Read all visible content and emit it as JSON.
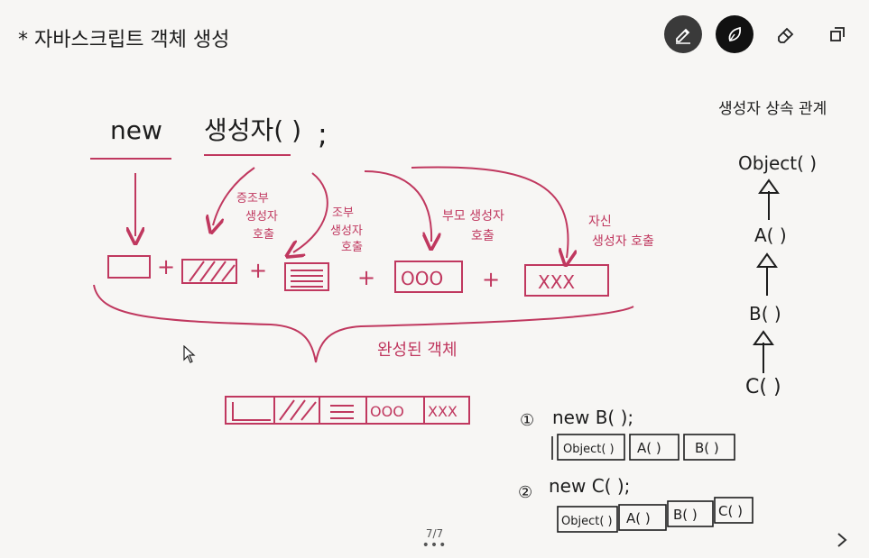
{
  "toolbar": {
    "tools": [
      {
        "icon": "pen-icon",
        "active": true
      },
      {
        "icon": "marker-icon",
        "active": true
      },
      {
        "icon": "eraser-icon",
        "active": false
      },
      {
        "icon": "lasso-select-icon",
        "active": false
      }
    ]
  },
  "colors": {
    "pen_dark": "#1d1d1d",
    "pen_pink": "#c0385f",
    "canvas": "#f7f6f4"
  },
  "note": {
    "title": "* 자바스크립트 객체 생성",
    "expr_new": "new",
    "expr_ctor": "생성자( )",
    "expr_semicolon": ";",
    "label_grand": "증조부 생성자 호출",
    "label_grand_lines": [
      "증조부",
      "생성자",
      "호출"
    ],
    "label_grandparent": "조부 생성자 호출",
    "label_grandparent_lines": [
      "조부",
      "생성자",
      "호출"
    ],
    "label_parent": "부모 생성자 호출",
    "label_parent_lines": [
      "부모 생성자",
      "호출"
    ],
    "label_self": "자신 생성자 호출",
    "label_self_lines": [
      "자신",
      "생성자 호출"
    ],
    "boxes_plus": "+",
    "box_circles": "OOO",
    "box_x": "XXX",
    "completed_label": "완성된 객체",
    "inherit_title": "생성자 상속 관계",
    "chain": [
      "Object( )",
      "A( )",
      "B( )",
      "C( )"
    ],
    "ex1_num": "①",
    "ex1_expr": "new  B( );",
    "ex1_blocks": [
      "Object( )",
      "A( )",
      "B( )"
    ],
    "ex2_num": "②",
    "ex2_expr": "new  C( );",
    "ex2_blocks": [
      "Object( )",
      "A( )",
      "B( )",
      "C( )"
    ]
  },
  "pagination": {
    "label": "7/7",
    "dots": "•••"
  }
}
